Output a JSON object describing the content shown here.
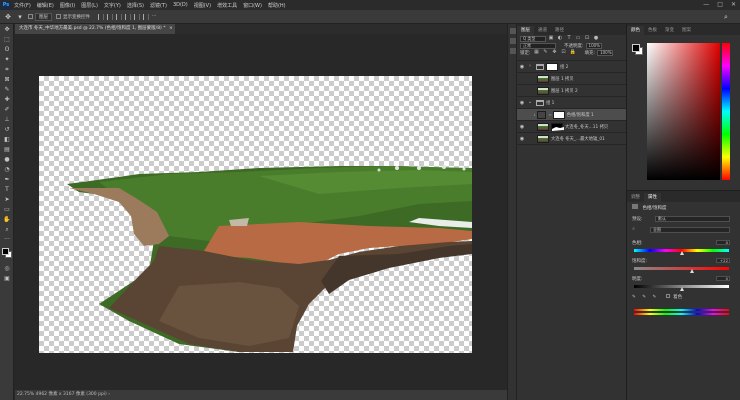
{
  "menubar": {
    "logo": "Ps",
    "items": [
      "文件(F)",
      "编辑(E)",
      "图像(I)",
      "图层(L)",
      "文字(Y)",
      "选择(S)",
      "滤镜(T)",
      "3D(D)",
      "视图(V)",
      "增效工具",
      "窗口(W)",
      "帮助(H)"
    ],
    "window_controls": [
      "—",
      "□",
      "✕"
    ]
  },
  "options": {
    "auto_select_value": "图层",
    "show_transform": "显示变换控件",
    "more": "···"
  },
  "document": {
    "tab_title": "大连市 冬天_中华地方最美.psd @ 22.7% (色相/饱和度 1, 图层蒙版/8) *",
    "close": "×"
  },
  "status": {
    "text": "22.75%   4962 像素 x 3167 像素 (300 ppi)   ›"
  },
  "layers": {
    "tabs": [
      "图层",
      "通道",
      "路径"
    ],
    "filter_label": "Q 类型",
    "mode_row": {
      "label": "正常",
      "opacity_label": "不透明度:",
      "opacity": "100%"
    },
    "lock_row": {
      "label": "锁定:",
      "fill_label": "填充:",
      "fill": "100%"
    },
    "items": [
      {
        "name": "组 2",
        "kind": "group",
        "visible": true,
        "indent": 0
      },
      {
        "name": "图层 1 拷贝",
        "kind": "photo",
        "visible": false,
        "indent": 1
      },
      {
        "name": "图层 1 拷贝 2",
        "kind": "photo",
        "visible": false,
        "indent": 1
      },
      {
        "name": "组 1",
        "kind": "group",
        "visible": true,
        "indent": 0
      },
      {
        "name": "色相/饱和度 1",
        "kind": "adjust",
        "visible": false,
        "indent": 1
      },
      {
        "name": "大连冬_冬天...11 拷贝",
        "kind": "photo_mask",
        "visible": true,
        "indent": 1
      },
      {
        "name": "大连冬 冬天_...最大地辐_01",
        "kind": "photo",
        "visible": true,
        "indent": 1
      }
    ]
  },
  "color_panel": {
    "tabs": [
      "颜色",
      "色板",
      "渐变",
      "图案"
    ]
  },
  "properties": {
    "tabs": [
      "调整",
      "属性"
    ],
    "panel_title": "色相/饱和度",
    "preset_label": "预设:",
    "preset_value": "默认",
    "channel_value": "全图",
    "hue": {
      "label": "色相:",
      "value": "0",
      "level": 0.5
    },
    "saturation": {
      "label": "饱和度:",
      "value": "+22",
      "level": 0.61
    },
    "lightness": {
      "label": "明度:",
      "value": "0",
      "level": 0.5
    },
    "colorize": "着色"
  }
}
